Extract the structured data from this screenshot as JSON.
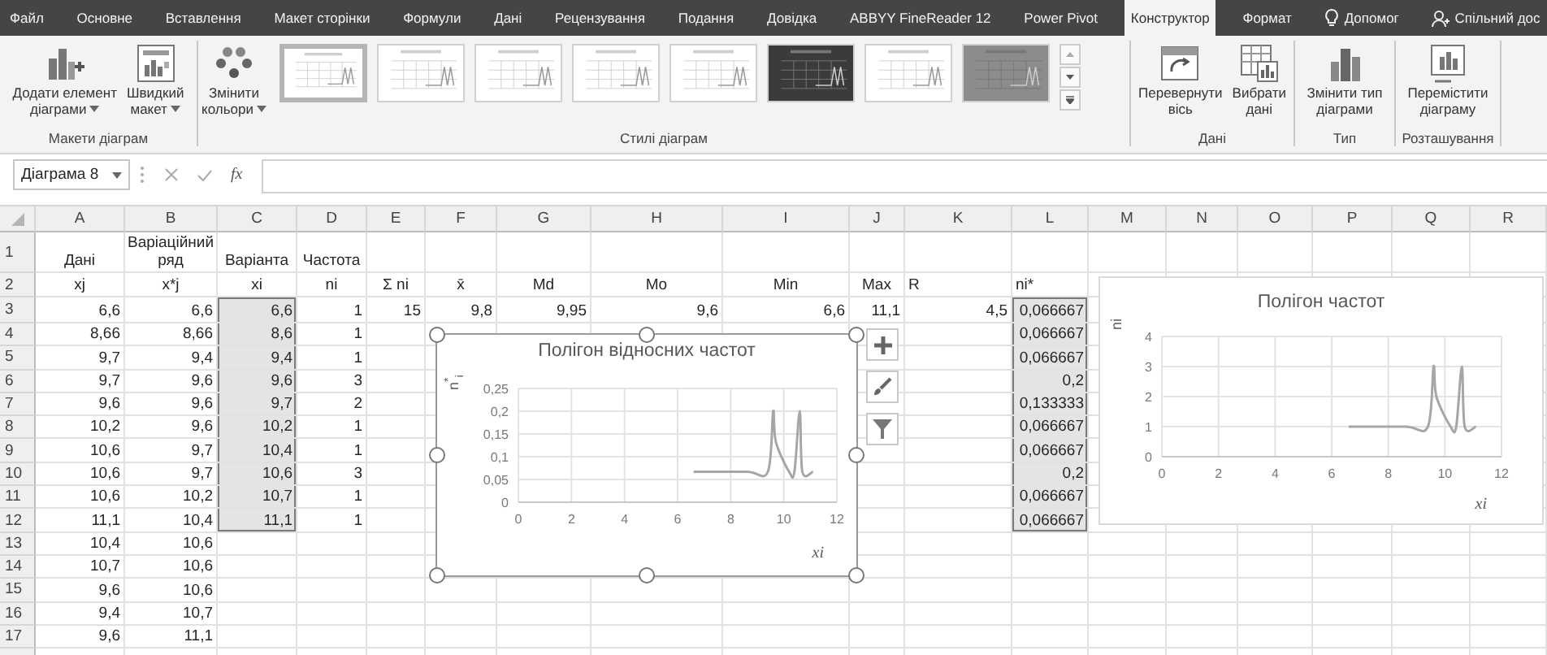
{
  "ribbon_tabs": [
    {
      "label": "Файл",
      "selected": false,
      "kind": "plain"
    },
    {
      "label": "Основне",
      "selected": false,
      "kind": "plain"
    },
    {
      "label": "Вставлення",
      "selected": false,
      "kind": "plain"
    },
    {
      "label": "Макет сторінки",
      "selected": false,
      "kind": "plain"
    },
    {
      "label": "Формули",
      "selected": false,
      "kind": "plain"
    },
    {
      "label": "Дані",
      "selected": false,
      "kind": "plain"
    },
    {
      "label": "Рецензування",
      "selected": false,
      "kind": "plain"
    },
    {
      "label": "Подання",
      "selected": false,
      "kind": "plain"
    },
    {
      "label": "Довідка",
      "selected": false,
      "kind": "plain"
    },
    {
      "label": "ABBYY FineReader 12",
      "selected": false,
      "kind": "plain"
    },
    {
      "label": "Power Pivot",
      "selected": false,
      "kind": "plain"
    },
    {
      "label": "Конструктор",
      "selected": true,
      "kind": "plain"
    },
    {
      "label": "Формат",
      "selected": false,
      "kind": "plain"
    },
    {
      "label": "Допомог",
      "selected": false,
      "kind": "help"
    },
    {
      "label": "Спільний дос",
      "selected": false,
      "kind": "share"
    }
  ],
  "ribbon_groups": [
    {
      "label": "Макети діаграм",
      "buttons": [
        {
          "kind": "add-element",
          "lines": [
            "Додати елемент",
            "діаграми"
          ],
          "dropdown": true
        },
        {
          "kind": "quick-layout",
          "lines": [
            "Швидкий",
            "макет"
          ],
          "dropdown": true
        }
      ]
    },
    {
      "label": "Стилі діаграм",
      "buttons": [
        {
          "kind": "colors",
          "lines": [
            "Змінити",
            "кольори"
          ],
          "dropdown": true
        }
      ],
      "styles": [
        {
          "kind": "light",
          "selected": true
        },
        {
          "kind": "light",
          "selected": false
        },
        {
          "kind": "light",
          "selected": false
        },
        {
          "kind": "light",
          "selected": false
        },
        {
          "kind": "light",
          "selected": false
        },
        {
          "kind": "dark",
          "selected": false
        },
        {
          "kind": "light",
          "selected": false
        },
        {
          "kind": "gray",
          "selected": false
        }
      ]
    },
    {
      "label": "Дані",
      "buttons": [
        {
          "kind": "switch",
          "lines": [
            "Перевернути",
            "вісь"
          ],
          "dropdown": false
        },
        {
          "kind": "select-data",
          "lines": [
            "Вибрати",
            "дані"
          ],
          "dropdown": false
        }
      ]
    },
    {
      "label": "Тип",
      "buttons": [
        {
          "kind": "change-type",
          "lines": [
            "Змінити тип",
            "діаграми"
          ],
          "dropdown": false
        }
      ]
    },
    {
      "label": "Розташування",
      "buttons": [
        {
          "kind": "move",
          "lines": [
            "Перемістити",
            "діаграму"
          ],
          "dropdown": false
        }
      ]
    }
  ],
  "formula_bar": {
    "name_box": "Діаграма 8",
    "function_label": "fx"
  },
  "sheet": {
    "columns": [
      "A",
      "B",
      "C",
      "D",
      "E",
      "F",
      "G",
      "H",
      "I",
      "J",
      "K",
      "L",
      "M",
      "N",
      "O",
      "P",
      "Q",
      "R"
    ],
    "rows": [
      {
        "number": "1",
        "cells": [
          {
            "text": "Дані",
            "selected": false
          },
          {
            "text": "Варіаційний ряд",
            "selected": false
          },
          {
            "text": "Варіанта",
            "selected": false
          },
          {
            "text": "Частота",
            "selected": false
          }
        ]
      },
      {
        "number": "2",
        "cells": [
          {
            "text": "xj",
            "selected": false
          },
          {
            "text": "x*j",
            "selected": false
          },
          {
            "text": "xi",
            "selected": false
          },
          {
            "text": "ni",
            "selected": false
          },
          {
            "text": "Σ ni",
            "selected": false
          },
          {
            "text": "x̄",
            "selected": false
          },
          {
            "text": "Md",
            "selected": false
          },
          {
            "text": "Mo",
            "selected": false
          },
          {
            "text": "Min",
            "selected": false
          },
          {
            "text": "Max",
            "selected": false
          },
          {
            "text": "R",
            "selected": false
          },
          {
            "text": "ni*",
            "selected": false
          }
        ]
      },
      {
        "number": "3",
        "cells": [
          {
            "text": "6,6",
            "selected": false
          },
          {
            "text": "6,6",
            "selected": false
          },
          {
            "text": "6,6",
            "selected": true
          },
          {
            "text": "1",
            "selected": false
          },
          {
            "text": "15",
            "selected": false
          },
          {
            "text": "9,8",
            "selected": false
          },
          {
            "text": "9,95",
            "selected": false
          },
          {
            "text": "9,6",
            "selected": false
          },
          {
            "text": "6,6",
            "selected": false
          },
          {
            "text": "11,1",
            "selected": false
          },
          {
            "text": "4,5",
            "selected": false
          },
          {
            "text": "0,066667",
            "selected": true
          }
        ]
      },
      {
        "number": "4",
        "cells": [
          {
            "text": "8,66",
            "selected": false
          },
          {
            "text": "8,66",
            "selected": false
          },
          {
            "text": "8,6",
            "selected": true
          },
          {
            "text": "1",
            "selected": false
          },
          {},
          {},
          {},
          {},
          {},
          {},
          {},
          {
            "text": "0,066667",
            "selected": true
          }
        ]
      },
      {
        "number": "5",
        "cells": [
          {
            "text": "9,7",
            "selected": false
          },
          {
            "text": "9,4",
            "selected": false
          },
          {
            "text": "9,4",
            "selected": true
          },
          {
            "text": "1",
            "selected": false
          },
          {},
          {},
          {},
          {},
          {},
          {},
          {},
          {
            "text": "0,066667",
            "selected": true
          }
        ]
      },
      {
        "number": "6",
        "cells": [
          {
            "text": "9,7",
            "selected": false
          },
          {
            "text": "9,6",
            "selected": false
          },
          {
            "text": "9,6",
            "selected": true
          },
          {
            "text": "3",
            "selected": false
          },
          {},
          {},
          {},
          {},
          {},
          {},
          {},
          {
            "text": "0,2",
            "selected": true
          }
        ]
      },
      {
        "number": "7",
        "cells": [
          {
            "text": "9,6",
            "selected": false
          },
          {
            "text": "9,6",
            "selected": false
          },
          {
            "text": "9,7",
            "selected": true
          },
          {
            "text": "2",
            "selected": false
          },
          {},
          {},
          {},
          {},
          {},
          {},
          {},
          {
            "text": "0,133333",
            "selected": true
          }
        ]
      },
      {
        "number": "8",
        "cells": [
          {
            "text": "10,2",
            "selected": false
          },
          {
            "text": "9,6",
            "selected": false
          },
          {
            "text": "10,2",
            "selected": true
          },
          {
            "text": "1",
            "selected": false
          },
          {},
          {},
          {},
          {},
          {},
          {},
          {},
          {
            "text": "0,066667",
            "selected": true
          }
        ]
      },
      {
        "number": "9",
        "cells": [
          {
            "text": "10,6",
            "selected": false
          },
          {
            "text": "9,7",
            "selected": false
          },
          {
            "text": "10,4",
            "selected": true
          },
          {
            "text": "1",
            "selected": false
          },
          {},
          {},
          {},
          {},
          {},
          {},
          {},
          {
            "text": "0,066667",
            "selected": true
          }
        ]
      },
      {
        "number": "10",
        "cells": [
          {
            "text": "10,6",
            "selected": false
          },
          {
            "text": "9,7",
            "selected": false
          },
          {
            "text": "10,6",
            "selected": true
          },
          {
            "text": "3",
            "selected": false
          },
          {},
          {},
          {},
          {},
          {},
          {},
          {},
          {
            "text": "0,2",
            "selected": true
          }
        ]
      },
      {
        "number": "11",
        "cells": [
          {
            "text": "10,6",
            "selected": false
          },
          {
            "text": "10,2",
            "selected": false
          },
          {
            "text": "10,7",
            "selected": true
          },
          {
            "text": "1",
            "selected": false
          },
          {},
          {},
          {},
          {},
          {},
          {},
          {},
          {
            "text": "0,066667",
            "selected": true
          }
        ]
      },
      {
        "number": "12",
        "cells": [
          {
            "text": "11,1",
            "selected": false
          },
          {
            "text": "10,4",
            "selected": false
          },
          {
            "text": "11,1",
            "selected": true
          },
          {
            "text": "1",
            "selected": false
          },
          {},
          {},
          {},
          {},
          {},
          {},
          {},
          {
            "text": "0,066667",
            "selected": true
          }
        ]
      },
      {
        "number": "13",
        "cells": [
          {
            "text": "10,4",
            "selected": false
          },
          {
            "text": "10,6",
            "selected": false
          }
        ]
      },
      {
        "number": "14",
        "cells": [
          {
            "text": "10,7",
            "selected": false
          },
          {
            "text": "10,6",
            "selected": false
          }
        ]
      },
      {
        "number": "15",
        "cells": [
          {
            "text": "9,6",
            "selected": false
          },
          {
            "text": "10,6",
            "selected": false
          }
        ]
      },
      {
        "number": "16",
        "cells": [
          {
            "text": "9,4",
            "selected": false
          },
          {
            "text": "10,7",
            "selected": false
          }
        ]
      },
      {
        "number": "17",
        "cells": [
          {
            "text": "9,6",
            "selected": false
          },
          {
            "text": "11,1",
            "selected": false
          }
        ]
      }
    ]
  },
  "charts": [
    {
      "selected": true,
      "chart_data": {
        "type": "line",
        "title": "Полігон відносних частот",
        "xlabel": "xi",
        "ylabel": "n$^{*}$$_{i}$",
        "grid": true,
        "x": [
          6.6,
          8.6,
          9.4,
          9.6,
          9.7,
          10.2,
          10.4,
          10.6,
          10.7,
          11.1
        ],
        "series": [
          {
            "color": "#a6a6a6",
            "values": [
              0.067,
              0.067,
              0.067,
              0.2,
              0.133,
              0.067,
              0.067,
              0.2,
              0.067,
              0.067
            ]
          }
        ],
        "xlim": [
          0,
          12
        ],
        "ylim": [
          0,
          0.25
        ],
        "xticks": [
          0,
          2,
          4,
          6,
          8,
          10,
          12
        ],
        "yticks": [
          {
            "value": 0,
            "label": "0"
          },
          {
            "value": 0.05,
            "label": "0,05"
          },
          {
            "value": 0.1,
            "label": "0,1"
          },
          {
            "value": 0.15,
            "label": "0,15"
          },
          {
            "value": 0.2,
            "label": "0,2"
          },
          {
            "value": 0.25,
            "label": "0,25"
          }
        ]
      }
    },
    {
      "selected": false,
      "chart_data": {
        "type": "line",
        "title": "Полігон частот",
        "xlabel": "xi",
        "ylabel": "ni",
        "grid": true,
        "x": [
          6.6,
          8.6,
          9.4,
          9.6,
          9.7,
          10.2,
          10.4,
          10.6,
          10.7,
          11.1
        ],
        "series": [
          {
            "color": "#a6a6a6",
            "values": [
              1,
              1,
              1,
              3,
              2,
              1,
              1,
              3,
              1,
              1
            ]
          }
        ],
        "xlim": [
          0,
          12
        ],
        "ylim": [
          0,
          4
        ],
        "xticks": [
          0,
          2,
          4,
          6,
          8,
          10,
          12
        ],
        "yticks": [
          0,
          1,
          2,
          3,
          4
        ]
      }
    }
  ]
}
